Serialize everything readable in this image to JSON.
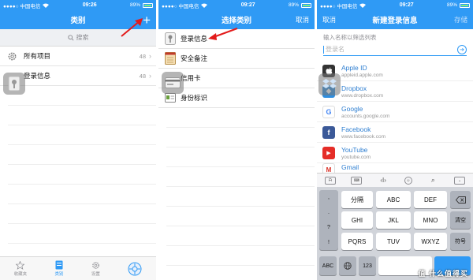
{
  "status": {
    "carrier": "●●●●○ 中国电信",
    "wifi": "wifi",
    "battery": "89%",
    "screens": [
      {
        "time": "09:26"
      },
      {
        "time": "09:27"
      },
      {
        "time": "09:27"
      }
    ]
  },
  "screen1": {
    "title": "类别",
    "add_icon": "+",
    "search_placeholder": "搜索",
    "rows": [
      {
        "label": "所有项目",
        "count": "48",
        "icon": "gear-icon"
      },
      {
        "label": "登录信息",
        "count": "48",
        "icon": "key-icon"
      }
    ],
    "tabs": [
      {
        "label": "收藏夹"
      },
      {
        "label": "类别"
      },
      {
        "label": "设置"
      }
    ]
  },
  "screen2": {
    "title": "选择类别",
    "cancel": "取消",
    "rows": [
      {
        "label": "登录信息",
        "icon": "key-icon"
      },
      {
        "label": "安全备注",
        "icon": "note-icon"
      },
      {
        "label": "信用卡",
        "icon": "card-icon"
      },
      {
        "label": "身份标识",
        "icon": "id-icon"
      }
    ]
  },
  "screen3": {
    "title": "新建登录信息",
    "cancel": "取消",
    "save": "存储",
    "hint": "输入名称以筛选列表",
    "login_placeholder": "登录名",
    "services": [
      {
        "name": "Apple ID",
        "url": "appleid.apple.com",
        "color": "#333333",
        "glyph": ""
      },
      {
        "name": "Dropbox",
        "url": "www.dropbox.com",
        "color": "#2e8ee0",
        "glyph": "◆"
      },
      {
        "name": "Google",
        "url": "accounts.google.com",
        "color": "#ffffff",
        "glyph": "G"
      },
      {
        "name": "Facebook",
        "url": "www.facebook.com",
        "color": "#3b5998",
        "glyph": "f"
      },
      {
        "name": "YouTube",
        "url": "youtube.com",
        "color": "#e52d27",
        "glyph": "▶"
      },
      {
        "name": "Gmail",
        "url": "",
        "color": "#ffffff",
        "glyph": "M"
      }
    ],
    "keys": {
      "row1": [
        {
          "main": "分隔"
        },
        {
          "main": "ABC"
        },
        {
          "main": "DEF"
        }
      ],
      "row2": [
        {
          "main": "GHI"
        },
        {
          "main": "JKL"
        },
        {
          "main": "MNO"
        }
      ],
      "row3": [
        {
          "main": "PQRS"
        },
        {
          "main": "TUV"
        },
        {
          "main": "WXYZ"
        }
      ],
      "side_left": [
        ",",
        ".",
        "?",
        "!"
      ],
      "clear": "清空",
      "symbol": "符号",
      "abc": "ABC",
      "num": "123"
    }
  },
  "watermark": "值 什么值得买"
}
